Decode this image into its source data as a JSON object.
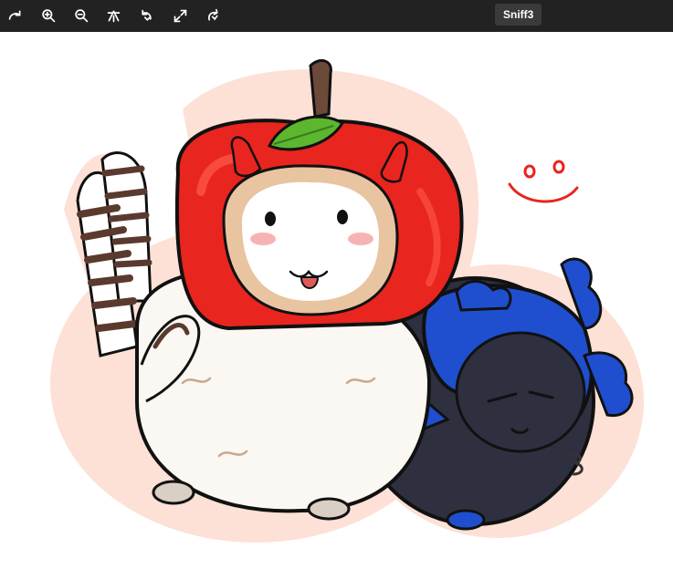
{
  "window": {
    "title": "Sniff3"
  },
  "toolbar": {
    "buttons": [
      {
        "name": "rotate-button",
        "icon": "rotate-right-icon"
      },
      {
        "name": "zoom-in-button",
        "icon": "zoom-in-icon"
      },
      {
        "name": "zoom-out-button",
        "icon": "zoom-out-icon"
      },
      {
        "name": "flip-button",
        "icon": "flip-icon"
      },
      {
        "name": "rotate-left-button",
        "icon": "rotate-left-icon"
      },
      {
        "name": "fullscreen-button",
        "icon": "expand-icon"
      },
      {
        "name": "reset-button",
        "icon": "reset-icon"
      }
    ]
  },
  "image": {
    "subject_icon": "illustration",
    "colors": {
      "apple_red": "#e8251e",
      "apple_highlight": "#ff5a4a",
      "leaf_green": "#5cb62e",
      "stem_brown": "#6b4a3a",
      "body_white": "#fbf7f2",
      "face_tan": "#e8c4a0",
      "cheek_pink": "#f7b3b3",
      "tongue_red": "#e05a5a",
      "blue_hood": "#1f4fcf",
      "dark_body": "#2e3040",
      "outline_glow": "#fde0d6",
      "tail_brown": "#5a3a2e",
      "toolbar_bg": "#222222"
    }
  }
}
